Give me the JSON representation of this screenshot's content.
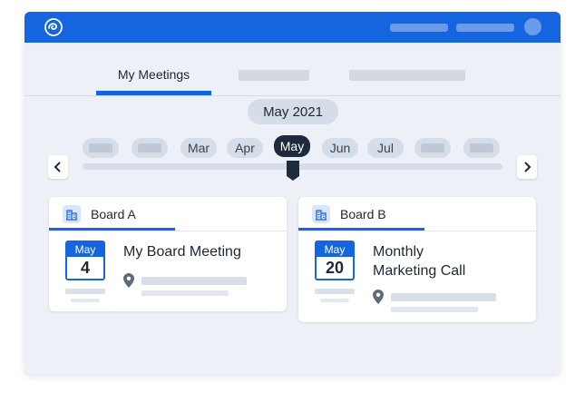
{
  "colors": {
    "brand": "#1565e0",
    "selected_month": "#1e2b3c",
    "background": "#edf1f7"
  },
  "header": {
    "logo_icon": "app-logo-icon",
    "avatar_icon": "avatar"
  },
  "tabs": [
    {
      "label": "My Meetings",
      "active": true
    }
  ],
  "month_picker": {
    "current": "May 2021",
    "months": [
      {
        "label": ""
      },
      {
        "label": ""
      },
      {
        "label": "Mar"
      },
      {
        "label": "Apr"
      },
      {
        "label": "May",
        "selected": true
      },
      {
        "label": "Jun"
      },
      {
        "label": "Jul"
      },
      {
        "label": ""
      },
      {
        "label": ""
      }
    ],
    "prev_icon": "chevron-left-icon",
    "next_icon": "chevron-right-icon"
  },
  "boards": [
    {
      "name": "Board A",
      "icon": "building-icon",
      "meeting": {
        "month": "May",
        "day": "4",
        "title": "My Board Meeting"
      }
    },
    {
      "name": "Board B",
      "icon": "building-icon",
      "meeting": {
        "month": "May",
        "day": "20",
        "title": "Monthly\nMarketing Call"
      }
    }
  ]
}
